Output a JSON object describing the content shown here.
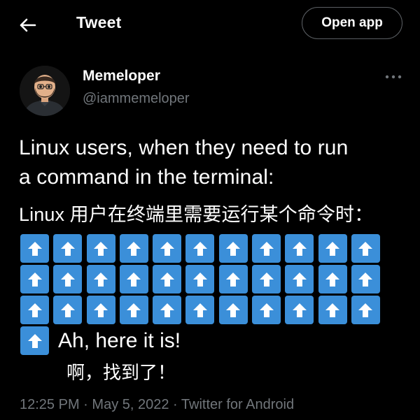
{
  "header": {
    "title": "Tweet",
    "open_app_label": "Open app"
  },
  "author": {
    "name": "Memeloper",
    "handle": "@iammemeloper"
  },
  "tweet": {
    "line1": "Linux users, when they need to run",
    "line2": "a command in the terminal:",
    "line3_cn": "Linux 用户在终端里需要运行某个命令时：",
    "arrow_emoji_count": 34,
    "arrow_emoji_color": "#3b8fd9",
    "reply_en": "Ah, here it is!",
    "reply_cn": "啊，找到了！"
  },
  "meta": {
    "time": "12:25 PM",
    "date": "May 5, 2022",
    "source": "Twitter for Android",
    "separator": "·"
  },
  "icons": [
    "back-arrow-icon",
    "more-options-icon",
    "up-arrow-emoji"
  ]
}
